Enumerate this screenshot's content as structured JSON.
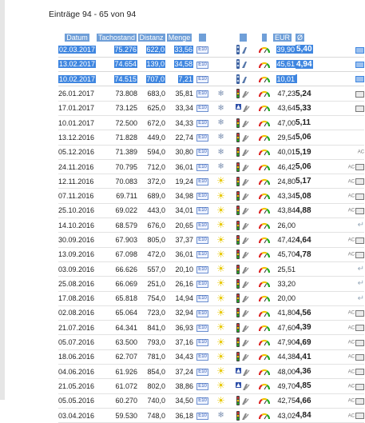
{
  "title": "Einträge 94 - 65 von 94",
  "headers": {
    "date": "Datum",
    "odometer": "Tachostand",
    "distance": "Distanz",
    "quantity": "Menge",
    "eur": "EUR",
    "consumption": "Ø"
  },
  "colors": {
    "selection": "#3f86e0",
    "header": "#6f9fd8"
  },
  "icons": {
    "tag": "E10"
  },
  "rows": [
    {
      "date": "02.03.2017",
      "km": "75.276",
      "dist": "622,0",
      "qty": "33,56",
      "weather": "none",
      "pump": "sel",
      "eur": "39,90",
      "cons": "5,40",
      "ac": "monitor",
      "selected": true
    },
    {
      "date": "13.02.2017",
      "km": "74.654",
      "dist": "139,0",
      "qty": "34,58",
      "weather": "none",
      "pump": "sel",
      "eur": "45,61",
      "cons": "4,94",
      "ac": "monitor",
      "selected": true
    },
    {
      "date": "10.02.2017",
      "km": "74.515",
      "dist": "707,0",
      "qty": "7,21",
      "weather": "none",
      "pump": "sel",
      "eur": "10,01",
      "cons": "",
      "ac": "monitor",
      "selected": true
    },
    {
      "date": "26.01.2017",
      "km": "73.808",
      "dist": "683,0",
      "qty": "35,81",
      "weather": "snow",
      "pump": "light",
      "eur": "47,23",
      "cons": "5,24",
      "ac": "monitor",
      "selected": false
    },
    {
      "date": "17.01.2017",
      "km": "73.125",
      "dist": "625,0",
      "qty": "33,34",
      "weather": "snow",
      "pump": "road",
      "eur": "43,64",
      "cons": "5,33",
      "ac": "monitor",
      "selected": false
    },
    {
      "date": "10.01.2017",
      "km": "72.500",
      "dist": "672,0",
      "qty": "34,33",
      "weather": "snow",
      "pump": "light",
      "eur": "47,00",
      "cons": "5,11",
      "ac": "none",
      "selected": false
    },
    {
      "date": "13.12.2016",
      "km": "71.828",
      "dist": "449,0",
      "qty": "22,74",
      "weather": "snow",
      "pump": "light",
      "eur": "29,54",
      "cons": "5,06",
      "ac": "none",
      "selected": false
    },
    {
      "date": "05.12.2016",
      "km": "71.389",
      "dist": "594,0",
      "qty": "30,80",
      "weather": "snow",
      "pump": "light",
      "eur": "40,01",
      "cons": "5,19",
      "ac": "ac",
      "selected": false
    },
    {
      "date": "24.11.2016",
      "km": "70.795",
      "dist": "712,0",
      "qty": "36,01",
      "weather": "snow",
      "pump": "light",
      "eur": "46,42",
      "cons": "5,06",
      "ac": "acmon",
      "selected": false
    },
    {
      "date": "12.11.2016",
      "km": "70.083",
      "dist": "372,0",
      "qty": "19,24",
      "weather": "sun",
      "pump": "light",
      "eur": "24,80",
      "cons": "5,17",
      "ac": "acmon",
      "selected": false
    },
    {
      "date": "07.11.2016",
      "km": "69.711",
      "dist": "689,0",
      "qty": "34,98",
      "weather": "sun",
      "pump": "light",
      "eur": "43,34",
      "cons": "5,08",
      "ac": "acmon",
      "selected": false
    },
    {
      "date": "25.10.2016",
      "km": "69.022",
      "dist": "443,0",
      "qty": "34,01",
      "weather": "sun",
      "pump": "light",
      "eur": "43,84",
      "cons": "4,88",
      "ac": "acmon",
      "selected": false
    },
    {
      "date": "14.10.2016",
      "km": "68.579",
      "dist": "676,0",
      "qty": "20,65",
      "weather": "sun",
      "pump": "light",
      "eur": "26,00",
      "cons": "",
      "ac": "back",
      "selected": false
    },
    {
      "date": "30.09.2016",
      "km": "67.903",
      "dist": "805,0",
      "qty": "37,37",
      "weather": "sun",
      "pump": "light",
      "eur": "47,42",
      "cons": "4,64",
      "ac": "acmon",
      "selected": false
    },
    {
      "date": "13.09.2016",
      "km": "67.098",
      "dist": "472,0",
      "qty": "36,01",
      "weather": "sun",
      "pump": "light",
      "eur": "45,70",
      "cons": "4,78",
      "ac": "acmon",
      "selected": false
    },
    {
      "date": "03.09.2016",
      "km": "66.626",
      "dist": "557,0",
      "qty": "20,10",
      "weather": "sun",
      "pump": "light",
      "eur": "25,51",
      "cons": "",
      "ac": "back",
      "selected": false
    },
    {
      "date": "25.08.2016",
      "km": "66.069",
      "dist": "251,0",
      "qty": "26,16",
      "weather": "sun",
      "pump": "light",
      "eur": "33,20",
      "cons": "",
      "ac": "back",
      "selected": false
    },
    {
      "date": "17.08.2016",
      "km": "65.818",
      "dist": "754,0",
      "qty": "14,94",
      "weather": "sun",
      "pump": "light",
      "eur": "20,00",
      "cons": "",
      "ac": "back",
      "selected": false
    },
    {
      "date": "02.08.2016",
      "km": "65.064",
      "dist": "723,0",
      "qty": "32,94",
      "weather": "sun",
      "pump": "light",
      "eur": "41,80",
      "cons": "4,56",
      "ac": "acmon",
      "selected": false
    },
    {
      "date": "21.07.2016",
      "km": "64.341",
      "dist": "841,0",
      "qty": "36,93",
      "weather": "sun",
      "pump": "light",
      "eur": "47,60",
      "cons": "4,39",
      "ac": "acmon",
      "selected": false
    },
    {
      "date": "05.07.2016",
      "km": "63.500",
      "dist": "793,0",
      "qty": "37,16",
      "weather": "sun",
      "pump": "light",
      "eur": "47,90",
      "cons": "4,69",
      "ac": "acmon",
      "selected": false
    },
    {
      "date": "18.06.2016",
      "km": "62.707",
      "dist": "781,0",
      "qty": "34,43",
      "weather": "sun",
      "pump": "light",
      "eur": "44,38",
      "cons": "4,41",
      "ac": "acmon",
      "selected": false
    },
    {
      "date": "04.06.2016",
      "km": "61.926",
      "dist": "854,0",
      "qty": "37,24",
      "weather": "sun",
      "pump": "road",
      "eur": "48,00",
      "cons": "4,36",
      "ac": "acmon",
      "selected": false
    },
    {
      "date": "21.05.2016",
      "km": "61.072",
      "dist": "802,0",
      "qty": "38,86",
      "weather": "sun",
      "pump": "road",
      "eur": "49,70",
      "cons": "4,85",
      "ac": "acmon",
      "selected": false
    },
    {
      "date": "05.05.2016",
      "km": "60.270",
      "dist": "740,0",
      "qty": "34,50",
      "weather": "sun",
      "pump": "light",
      "eur": "42,75",
      "cons": "4,66",
      "ac": "acmon",
      "selected": false
    },
    {
      "date": "03.04.2016",
      "km": "59.530",
      "dist": "748,0",
      "qty": "36,18",
      "weather": "snow",
      "pump": "light",
      "eur": "43,02",
      "cons": "4,84",
      "ac": "acmon",
      "selected": false
    }
  ]
}
